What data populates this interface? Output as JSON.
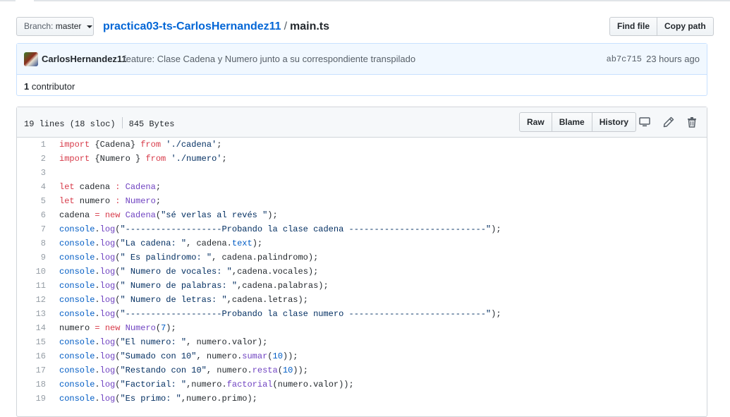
{
  "branch": {
    "prefix": "Branch:",
    "name": "master"
  },
  "breadcrumb": {
    "repo": "practica03-ts-CarlosHernandez11",
    "separator": "/",
    "file": "main.ts"
  },
  "file_nav": {
    "find_file": "Find file",
    "copy_path": "Copy path"
  },
  "commit": {
    "author": "CarlosHernandez11",
    "message": "feature: Clase Cadena y Numero junto a su correspondiente transpilado",
    "sha": "ab7c715",
    "age": "23 hours ago"
  },
  "contributors": {
    "count": "1",
    "label": "contributor"
  },
  "file": {
    "lines_info": "19 lines (18 sloc)",
    "size": "845 Bytes",
    "actions": {
      "raw": "Raw",
      "blame": "Blame",
      "history": "History"
    }
  },
  "code_lines": [
    {
      "n": "1",
      "tokens": [
        [
          "kw",
          "import"
        ],
        [
          "pl",
          " {Cadena} "
        ],
        [
          "kw",
          "from"
        ],
        [
          "pl",
          " "
        ],
        [
          "st",
          "'./cadena'"
        ],
        [
          "pl",
          ";"
        ]
      ]
    },
    {
      "n": "2",
      "tokens": [
        [
          "kw",
          "import"
        ],
        [
          "pl",
          " {Numero } "
        ],
        [
          "kw",
          "from"
        ],
        [
          "pl",
          " "
        ],
        [
          "st",
          "'./numero'"
        ],
        [
          "pl",
          ";"
        ]
      ]
    },
    {
      "n": "3",
      "tokens": []
    },
    {
      "n": "4",
      "tokens": [
        [
          "kw",
          "let"
        ],
        [
          "pl",
          " cadena "
        ],
        [
          "kw",
          ":"
        ],
        [
          "pl",
          " "
        ],
        [
          "ty",
          "Cadena"
        ],
        [
          "pl",
          ";"
        ]
      ]
    },
    {
      "n": "5",
      "tokens": [
        [
          "kw",
          "let"
        ],
        [
          "pl",
          " numero "
        ],
        [
          "kw",
          ":"
        ],
        [
          "pl",
          " "
        ],
        [
          "ty",
          "Numero"
        ],
        [
          "pl",
          ";"
        ]
      ]
    },
    {
      "n": "6",
      "tokens": [
        [
          "pl",
          "cadena "
        ],
        [
          "kw",
          "="
        ],
        [
          "pl",
          " "
        ],
        [
          "kw",
          "new"
        ],
        [
          "pl",
          " "
        ],
        [
          "ty",
          "Cadena"
        ],
        [
          "pl",
          "("
        ],
        [
          "st",
          "\"sé verlas al revés \""
        ],
        [
          "pl",
          ");"
        ]
      ]
    },
    {
      "n": "7",
      "tokens": [
        [
          "fn",
          "console"
        ],
        [
          "pl",
          "."
        ],
        [
          "ty",
          "log"
        ],
        [
          "pl",
          "("
        ],
        [
          "st",
          "\"-------------------Probando la clase cadena ---------------------------\""
        ],
        [
          "pl",
          ");"
        ]
      ]
    },
    {
      "n": "8",
      "tokens": [
        [
          "fn",
          "console"
        ],
        [
          "pl",
          "."
        ],
        [
          "ty",
          "log"
        ],
        [
          "pl",
          "("
        ],
        [
          "st",
          "\"La cadena: \""
        ],
        [
          "pl",
          ", cadena."
        ],
        [
          "fn",
          "text"
        ],
        [
          "pl",
          ");"
        ]
      ]
    },
    {
      "n": "9",
      "tokens": [
        [
          "fn",
          "console"
        ],
        [
          "pl",
          "."
        ],
        [
          "ty",
          "log"
        ],
        [
          "pl",
          "("
        ],
        [
          "st",
          "\" Es palindromo: \""
        ],
        [
          "pl",
          ", cadena.palindromo);"
        ]
      ]
    },
    {
      "n": "10",
      "tokens": [
        [
          "fn",
          "console"
        ],
        [
          "pl",
          "."
        ],
        [
          "ty",
          "log"
        ],
        [
          "pl",
          "("
        ],
        [
          "st",
          "\" Numero de vocales: \""
        ],
        [
          "pl",
          ",cadena.vocales);"
        ]
      ]
    },
    {
      "n": "11",
      "tokens": [
        [
          "fn",
          "console"
        ],
        [
          "pl",
          "."
        ],
        [
          "ty",
          "log"
        ],
        [
          "pl",
          "("
        ],
        [
          "st",
          "\" Numero de palabras: \""
        ],
        [
          "pl",
          ",cadena.palabras);"
        ]
      ]
    },
    {
      "n": "12",
      "tokens": [
        [
          "fn",
          "console"
        ],
        [
          "pl",
          "."
        ],
        [
          "ty",
          "log"
        ],
        [
          "pl",
          "("
        ],
        [
          "st",
          "\" Numero de letras: \""
        ],
        [
          "pl",
          ",cadena.letras);"
        ]
      ]
    },
    {
      "n": "13",
      "tokens": [
        [
          "fn",
          "console"
        ],
        [
          "pl",
          "."
        ],
        [
          "ty",
          "log"
        ],
        [
          "pl",
          "("
        ],
        [
          "st",
          "\"-------------------Probando la clase numero ---------------------------\""
        ],
        [
          "pl",
          ");"
        ]
      ]
    },
    {
      "n": "14",
      "tokens": [
        [
          "pl",
          "numero "
        ],
        [
          "kw",
          "="
        ],
        [
          "pl",
          " "
        ],
        [
          "kw",
          "new"
        ],
        [
          "pl",
          " "
        ],
        [
          "ty",
          "Numero"
        ],
        [
          "pl",
          "("
        ],
        [
          "fn",
          "7"
        ],
        [
          "pl",
          ");"
        ]
      ]
    },
    {
      "n": "15",
      "tokens": [
        [
          "fn",
          "console"
        ],
        [
          "pl",
          "."
        ],
        [
          "ty",
          "log"
        ],
        [
          "pl",
          "("
        ],
        [
          "st",
          "\"El numero: \""
        ],
        [
          "pl",
          ", numero.valor);"
        ]
      ]
    },
    {
      "n": "16",
      "tokens": [
        [
          "fn",
          "console"
        ],
        [
          "pl",
          "."
        ],
        [
          "ty",
          "log"
        ],
        [
          "pl",
          "("
        ],
        [
          "st",
          "\"Sumado con 10\""
        ],
        [
          "pl",
          ", numero."
        ],
        [
          "ty",
          "sumar"
        ],
        [
          "pl",
          "("
        ],
        [
          "fn",
          "10"
        ],
        [
          "pl",
          "));"
        ]
      ]
    },
    {
      "n": "17",
      "tokens": [
        [
          "fn",
          "console"
        ],
        [
          "pl",
          "."
        ],
        [
          "ty",
          "log"
        ],
        [
          "pl",
          "("
        ],
        [
          "st",
          "\"Restando con 10\""
        ],
        [
          "pl",
          ", numero."
        ],
        [
          "ty",
          "resta"
        ],
        [
          "pl",
          "("
        ],
        [
          "fn",
          "10"
        ],
        [
          "pl",
          "));"
        ]
      ]
    },
    {
      "n": "18",
      "tokens": [
        [
          "fn",
          "console"
        ],
        [
          "pl",
          "."
        ],
        [
          "ty",
          "log"
        ],
        [
          "pl",
          "("
        ],
        [
          "st",
          "\"Factorial: \""
        ],
        [
          "pl",
          ",numero."
        ],
        [
          "ty",
          "factorial"
        ],
        [
          "pl",
          "(numero.valor));"
        ]
      ]
    },
    {
      "n": "19",
      "tokens": [
        [
          "fn",
          "console"
        ],
        [
          "pl",
          "."
        ],
        [
          "ty",
          "log"
        ],
        [
          "pl",
          "("
        ],
        [
          "st",
          "\"Es primo: \""
        ],
        [
          "pl",
          ",numero.primo);"
        ]
      ]
    }
  ],
  "icons": {
    "desktop": "desktop-icon",
    "edit": "pencil-icon",
    "delete": "trash-icon"
  },
  "colors": {
    "link": "#0366d6",
    "keyword": "#d73a49",
    "type": "#6f42c1",
    "string": "#032f62",
    "constant": "#005cc5",
    "commit_bg": "#f1f8ff"
  }
}
